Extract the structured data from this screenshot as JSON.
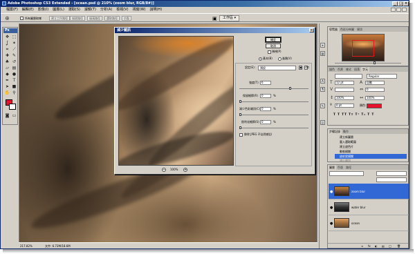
{
  "app": {
    "title": "Adobe Photoshop CS3 Extended - [ocean.psd @ 210% (zoom blur, RGB/8#)]",
    "title_controls": [
      "_",
      "□",
      "×"
    ]
  },
  "menu": [
    "檔案(F)",
    "編輯(E)",
    "影像(I)",
    "圖層(L)",
    "選取(S)",
    "濾鏡(T)",
    "分析(A)",
    "檢視(V)",
    "視窗(W)",
    "說明(H)"
  ],
  "options_bar": {
    "sample_all_layers": "所有圖層取樣",
    "buttons": [
      "建立工作路徑",
      "描邊路徑",
      "填滿路徑",
      "選取路徑",
      "仿製"
    ],
    "workspace": "工作區 ▾"
  },
  "toolbox": {
    "header": "Ps",
    "colors": {
      "foreground": "#e8122b",
      "background": "#ffffff"
    }
  },
  "status": {
    "zoom": "217.82%",
    "doc": "文件: 6.72M/18.6M"
  },
  "dialog": {
    "title": "減少雜訊",
    "close": "×",
    "buttons": {
      "ok": "確定",
      "cancel": "取消"
    },
    "preview_checkbox": "預視(P)",
    "mode_basic": "基本(B)",
    "mode_advanced": "進階(V)",
    "settings_label": "設定(E):",
    "settings_value": "預設",
    "strength_label": "強度(T):",
    "strength_value": "6",
    "preserve_details_label": "保留細節(R)",
    "preserve_details_value": "0",
    "reduce_color_label": "減少色彩雜訊(C)",
    "reduce_color_value": "0",
    "sharpen_label": "銳利化細節(S)",
    "sharpen_value": "0",
    "percent": "%",
    "jpeg_checkbox": "移除 JPEG 不自然感(J)",
    "zoom_value": "100%",
    "zoom_out": "−",
    "zoom_in": "+"
  },
  "panels": {
    "navigator_tabs": [
      "導覽器",
      "色彩分佈圖",
      "資訊"
    ],
    "character_tabs": [
      "錨色",
      "色票",
      "樣式",
      "段落",
      "字元"
    ],
    "character": {
      "font_style": "Regular",
      "size": "12 pt",
      "leading": "自動",
      "tracking": "0",
      "scale": "100%",
      "baseline": "0 pt",
      "color_label": "顏色:",
      "color": "#e8122b"
    },
    "history_tabs": [
      "步驟記錄",
      "動作"
    ],
    "history": [
      {
        "label": "建立新圖層",
        "state": "normal"
      },
      {
        "label": "載入選取範圍",
        "state": "normal"
      },
      {
        "label": "建立遮色片",
        "state": "normal"
      },
      {
        "label": "動態模糊",
        "state": "normal"
      },
      {
        "label": "放射狀模糊",
        "state": "selected"
      },
      {
        "label": "減少雜訊",
        "state": "grey"
      }
    ],
    "layers_tabs": [
      "圖層",
      "色版",
      "路徑"
    ],
    "layers": [
      {
        "name": "zoom blur",
        "selected": true
      },
      {
        "name": "water blur",
        "selected": false
      },
      {
        "name": "ocean",
        "selected": false
      }
    ],
    "layers_footer": [
      "∞",
      "fx",
      "◐",
      "▤",
      "□",
      "🗑"
    ]
  }
}
